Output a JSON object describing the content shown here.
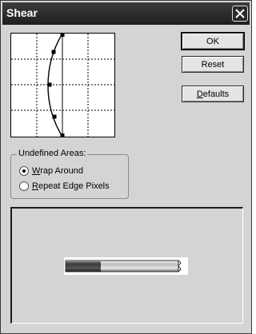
{
  "window": {
    "title": "Shear",
    "close_glyph": "✕"
  },
  "buttons": {
    "ok": "OK",
    "reset": "Reset",
    "defaults_prefix": "",
    "defaults_mnemonic": "D",
    "defaults_rest": "efaults"
  },
  "undefined_areas": {
    "legend": "Undefined Areas:",
    "options": [
      {
        "mnemonic": "W",
        "rest": "rap Around",
        "selected": true
      },
      {
        "mnemonic": "R",
        "rest": "epeat Edge Pixels",
        "selected": false
      }
    ]
  },
  "icons": {
    "close": "close-icon",
    "curve": "shear-curve",
    "radio": "radio-dot-icon"
  },
  "colors": {
    "titlebar": "#2a2a2a",
    "dialog_bg": "#d4d4d4",
    "graph_bg": "#ffffff"
  }
}
